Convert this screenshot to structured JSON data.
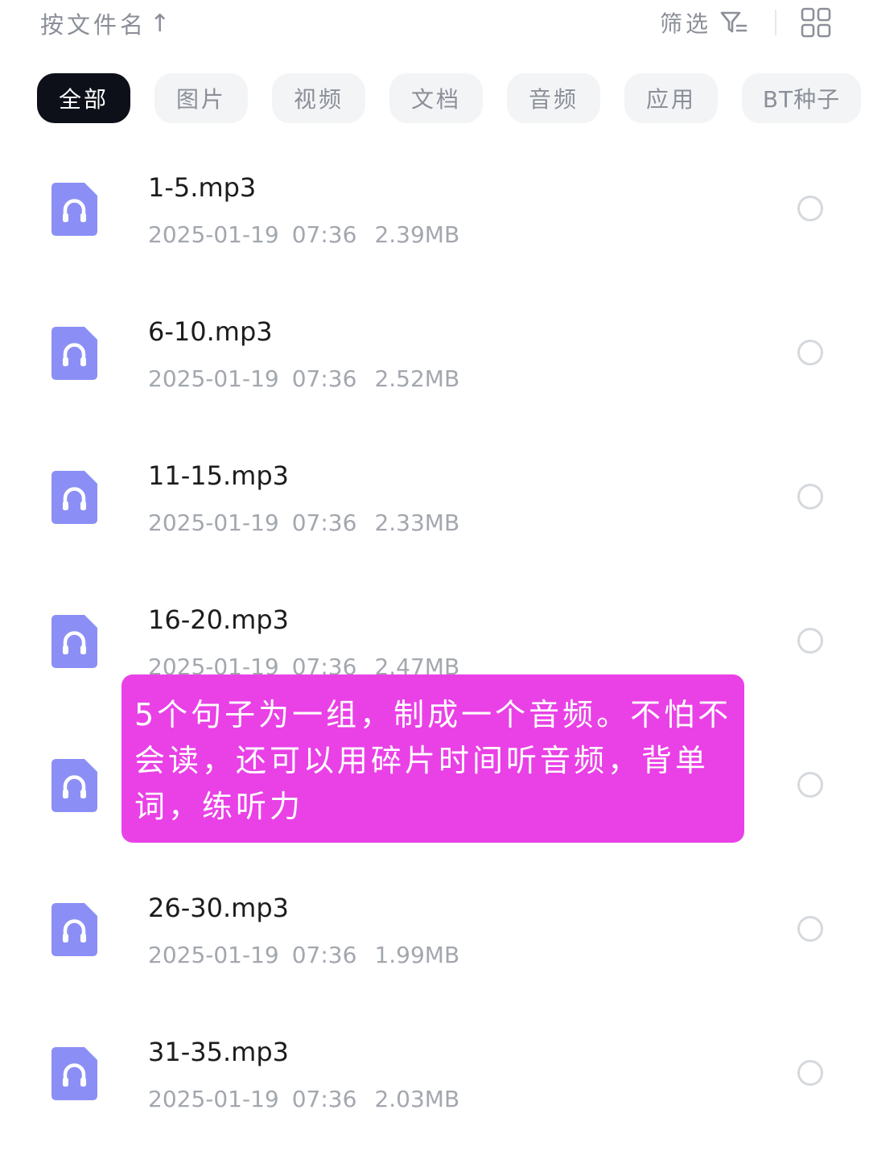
{
  "header": {
    "sort_label": "按文件名",
    "sort_arrow": "↑",
    "filter_label": "筛选",
    "filter_icon": "filter-icon",
    "view_icon": "grid-view-icon"
  },
  "tabs": [
    {
      "label": "全部",
      "active": true
    },
    {
      "label": "图片",
      "active": false
    },
    {
      "label": "视频",
      "active": false
    },
    {
      "label": "文档",
      "active": false
    },
    {
      "label": "音频",
      "active": false
    },
    {
      "label": "应用",
      "active": false
    },
    {
      "label": "BT种子",
      "active": false
    }
  ],
  "files": [
    {
      "name": "1-5.mp3",
      "date": "2025-01-19",
      "time": "07:36",
      "size": "2.39MB",
      "icon": "headphones-icon"
    },
    {
      "name": "6-10.mp3",
      "date": "2025-01-19",
      "time": "07:36",
      "size": "2.52MB",
      "icon": "headphones-icon"
    },
    {
      "name": "11-15.mp3",
      "date": "2025-01-19",
      "time": "07:36",
      "size": "2.33MB",
      "icon": "headphones-icon"
    },
    {
      "name": "16-20.mp3",
      "date": "2025-01-19",
      "time": "07:36",
      "size": "2.47MB",
      "icon": "headphones-icon"
    },
    {
      "name": "",
      "date": "",
      "time": "",
      "size": "",
      "icon": "headphones-icon"
    },
    {
      "name": "26-30.mp3",
      "date": "2025-01-19",
      "time": "07:36",
      "size": "1.99MB",
      "icon": "headphones-icon"
    },
    {
      "name": "31-35.mp3",
      "date": "2025-01-19",
      "time": "07:36",
      "size": "2.03MB",
      "icon": "headphones-icon"
    }
  ],
  "overlay": {
    "text": "5个句子为一组，制成一个音频。不怕不会读，还可以用碎片时间听音频，背单词，练听力"
  },
  "colors": {
    "accent_tab": "#0d1018",
    "icon_purple": "#8b8ff5",
    "overlay": "#e941e6"
  }
}
